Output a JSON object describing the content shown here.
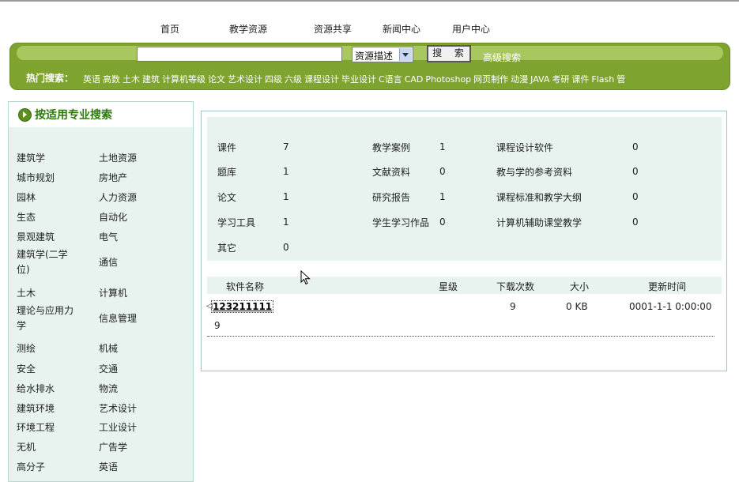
{
  "nav": [
    "首页",
    "教学资源",
    "资源共享",
    "新闻中心",
    "用户中心"
  ],
  "search": {
    "input_value": "",
    "select_value": "资源描述",
    "button_label": "搜 索",
    "advanced_label": "高级搜索",
    "hot_label": "热门搜索：",
    "hot_words": [
      "英语",
      "高数",
      "土木",
      "建筑",
      "计算机等级",
      "论文",
      "艺术设计",
      "四级",
      "六级",
      "课程设计",
      "毕业设计",
      "C语言",
      "CAD",
      "Photoshop",
      "网页制作",
      "动漫",
      "JAVA",
      "考研",
      "课件",
      "Flash",
      "管"
    ]
  },
  "sidebar": {
    "title": "按适用专业搜索",
    "rows": [
      [
        "建筑学",
        "土地资源"
      ],
      [
        "城市规划",
        "房地产"
      ],
      [
        "园林",
        "人力资源"
      ],
      [
        "生态",
        "自动化"
      ],
      [
        "景观建筑",
        "电气"
      ],
      [
        "建筑学(二学位)",
        "通信"
      ],
      [
        "土木",
        "计算机"
      ],
      [
        "理论与应用力学",
        "信息管理"
      ],
      [
        "测绘",
        "机械"
      ],
      [
        "安全",
        "交通"
      ],
      [
        "给水排水",
        "物流"
      ],
      [
        "建筑环境",
        "艺术设计"
      ],
      [
        "环境工程",
        "工业设计"
      ],
      [
        "无机",
        "广告学"
      ],
      [
        "高分子",
        "英语"
      ]
    ]
  },
  "stats": [
    {
      "label": "课件",
      "count": "7"
    },
    {
      "label": "教学案例",
      "count": "1"
    },
    {
      "label": "课程设计软件",
      "count": "0"
    },
    {
      "label": "题库",
      "count": "1"
    },
    {
      "label": "文献资料",
      "count": "0"
    },
    {
      "label": "教与学的参考资料",
      "count": "0"
    },
    {
      "label": "论文",
      "count": "1"
    },
    {
      "label": "研究报告",
      "count": "1"
    },
    {
      "label": "课程标准和教学大纲",
      "count": "0"
    },
    {
      "label": "学习工具",
      "count": "1"
    },
    {
      "label": "学生学习作品",
      "count": "0"
    },
    {
      "label": "计算机辅助课堂教学",
      "count": "0"
    },
    {
      "label": "其它",
      "count": "0"
    }
  ],
  "table": {
    "headers": [
      "软件名称",
      "星级",
      "下载次数",
      "大小",
      "更新时间"
    ],
    "rows": [
      {
        "name": "123211111",
        "name_suffix": "9",
        "stars": "",
        "downloads": "9",
        "size": "0 KB",
        "updated": "0001-1-1 0:00:00"
      }
    ]
  }
}
